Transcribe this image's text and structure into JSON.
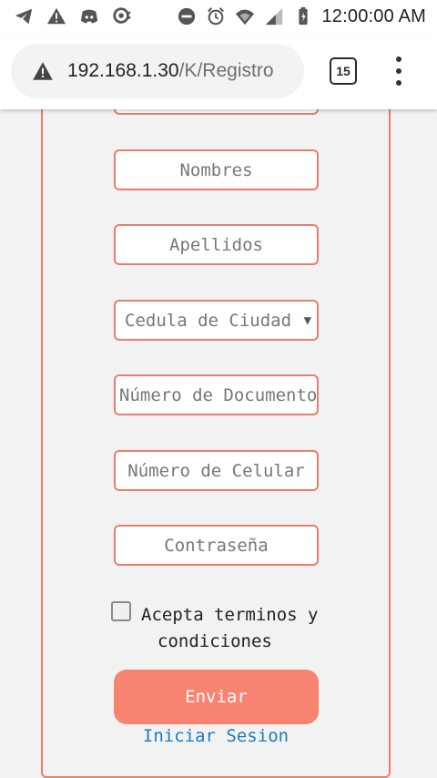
{
  "status_bar": {
    "time": "12:00:00 AM",
    "icons": [
      "telegram-icon",
      "alert-icon",
      "discord-icon",
      "app-icon",
      "dnd-icon",
      "alarm-icon",
      "wifi-icon",
      "signal-icon",
      "battery-icon"
    ]
  },
  "browser": {
    "url_host": "192.168.1.30",
    "url_path": "/K/Registro",
    "tab_count": "15"
  },
  "form": {
    "fields": [
      {
        "placeholder": "Nombres"
      },
      {
        "placeholder": "Apellidos"
      },
      {
        "value": "Cedula de Ciudad"
      },
      {
        "placeholder": "Número de Documento"
      },
      {
        "placeholder": "Número de Celular"
      },
      {
        "placeholder": "Contraseña"
      }
    ],
    "terms_line1": "Acepta terminos y",
    "terms_line2": "condiciones",
    "submit_label": "Enviar",
    "login_link": "Iniciar Sesion"
  },
  "colors": {
    "accent": "#ec7d6b",
    "button": "#f78371",
    "link": "#1a7dc4"
  }
}
